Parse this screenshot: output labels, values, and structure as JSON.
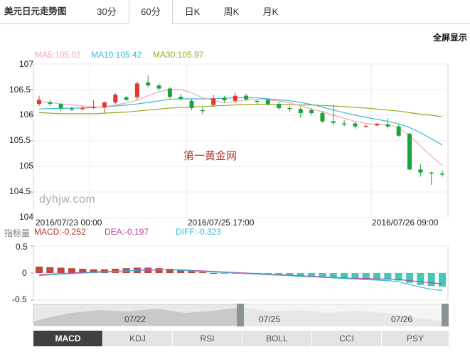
{
  "tabs": {
    "title": "美元日元走势图",
    "items": [
      "30分",
      "60分",
      "日K",
      "周K",
      "月K"
    ],
    "active": "60分"
  },
  "fullscreen_label": "全屏显示",
  "ma_legend": {
    "ma5": {
      "text": "MA5:105.02",
      "color": "#f2a5b5"
    },
    "ma10": {
      "text": "MA10:105.42",
      "color": "#3ab7d6"
    },
    "ma30": {
      "text": "MA30:105.97",
      "color": "#9aa61f"
    }
  },
  "watermark": {
    "cn": "第一黄金网",
    "url": "dyhjw.com"
  },
  "indicator_legend": {
    "label": "指标量",
    "macd": {
      "text": "MACD:-0.252",
      "color": "#b3352c"
    },
    "dea": {
      "text": "DEA:-0.197",
      "color": "#c23fa6"
    },
    "diff": {
      "text": "DIFF:-0.323",
      "color": "#3ab7d6"
    }
  },
  "navigator_labels": [
    "07/22",
    "07/25",
    "07/26"
  ],
  "indicator_tabs": [
    "MACD",
    "KDJ",
    "RSI",
    "BOLL",
    "CCI",
    "PSY"
  ],
  "indicator_active": "MACD",
  "chart_data": {
    "type": "candlestick",
    "price_axis": {
      "ticks": [
        "107",
        "106.5",
        "106",
        "105.5",
        "105",
        "104.5",
        "104"
      ],
      "ylim": [
        104,
        107
      ]
    },
    "time_axis": {
      "ticks": [
        "2016/07/23 00:00",
        "2016/07/25 17:00",
        "2016/07/26 09:00"
      ]
    },
    "candles": [
      {
        "o": 106.22,
        "c": 106.3,
        "h": 106.38,
        "l": 106.18
      },
      {
        "o": 106.25,
        "c": 106.22,
        "h": 106.3,
        "l": 106.18
      },
      {
        "o": 106.22,
        "c": 106.14,
        "h": 106.24,
        "l": 106.08
      },
      {
        "o": 106.13,
        "c": 106.11,
        "h": 106.16,
        "l": 106.08
      },
      {
        "o": 106.12,
        "c": 106.14,
        "h": 106.18,
        "l": 106.09
      },
      {
        "o": 106.14,
        "c": 106.16,
        "h": 106.3,
        "l": 106.12
      },
      {
        "o": 106.15,
        "c": 106.25,
        "h": 106.27,
        "l": 106.05
      },
      {
        "o": 106.25,
        "c": 106.4,
        "h": 106.44,
        "l": 106.22
      },
      {
        "o": 106.35,
        "c": 106.3,
        "h": 106.38,
        "l": 106.28
      },
      {
        "o": 106.35,
        "c": 106.62,
        "h": 106.66,
        "l": 106.3
      },
      {
        "o": 106.64,
        "c": 106.58,
        "h": 106.78,
        "l": 106.55
      },
      {
        "o": 106.58,
        "c": 106.52,
        "h": 106.62,
        "l": 106.48
      },
      {
        "o": 106.52,
        "c": 106.36,
        "h": 106.55,
        "l": 106.32
      },
      {
        "o": 106.36,
        "c": 106.32,
        "h": 106.42,
        "l": 106.28
      },
      {
        "o": 106.28,
        "c": 106.14,
        "h": 106.32,
        "l": 106.1
      },
      {
        "o": 106.1,
        "c": 106.08,
        "h": 106.16,
        "l": 106.02
      },
      {
        "o": 106.2,
        "c": 106.33,
        "h": 106.4,
        "l": 106.16
      },
      {
        "o": 106.34,
        "c": 106.29,
        "h": 106.38,
        "l": 106.25
      },
      {
        "o": 106.28,
        "c": 106.38,
        "h": 106.44,
        "l": 106.24
      },
      {
        "o": 106.38,
        "c": 106.31,
        "h": 106.42,
        "l": 106.28
      },
      {
        "o": 106.28,
        "c": 106.27,
        "h": 106.3,
        "l": 106.2
      },
      {
        "o": 106.3,
        "c": 106.22,
        "h": 106.32,
        "l": 106.19
      },
      {
        "o": 106.22,
        "c": 106.14,
        "h": 106.26,
        "l": 106.1
      },
      {
        "o": 106.14,
        "c": 106.12,
        "h": 106.18,
        "l": 106.06
      },
      {
        "o": 106.12,
        "c": 106.04,
        "h": 106.16,
        "l": 105.95
      },
      {
        "o": 106.1,
        "c": 106.04,
        "h": 106.14,
        "l": 106.0
      },
      {
        "o": 106.04,
        "c": 105.88,
        "h": 106.08,
        "l": 105.85
      },
      {
        "o": 105.88,
        "c": 105.85,
        "h": 106.2,
        "l": 105.8
      },
      {
        "o": 105.84,
        "c": 105.82,
        "h": 105.9,
        "l": 105.78
      },
      {
        "o": 105.84,
        "c": 105.78,
        "h": 105.88,
        "l": 105.74
      },
      {
        "o": 105.78,
        "c": 105.79,
        "h": 105.82,
        "l": 105.76
      },
      {
        "o": 105.8,
        "c": 105.83,
        "h": 105.85,
        "l": 105.79
      },
      {
        "o": 105.82,
        "c": 105.78,
        "h": 105.94,
        "l": 105.74
      },
      {
        "o": 105.78,
        "c": 105.6,
        "h": 105.82,
        "l": 105.58
      },
      {
        "o": 105.64,
        "c": 104.94,
        "h": 105.66,
        "l": 104.92
      },
      {
        "o": 104.94,
        "c": 104.88,
        "h": 105.05,
        "l": 104.8
      },
      {
        "o": 104.88,
        "c": 104.86,
        "h": 104.9,
        "l": 104.64
      },
      {
        "o": 104.86,
        "c": 104.84,
        "h": 104.92,
        "l": 104.8
      }
    ],
    "ma5": [
      106.26,
      106.25,
      106.22,
      106.2,
      106.18,
      106.16,
      106.16,
      106.2,
      106.24,
      106.29,
      106.38,
      106.46,
      106.5,
      106.5,
      106.44,
      106.34,
      106.29,
      106.24,
      106.26,
      106.3,
      106.31,
      106.3,
      106.28,
      106.24,
      106.18,
      106.12,
      106.07,
      106.0,
      105.94,
      105.88,
      105.84,
      105.82,
      105.81,
      105.76,
      105.6,
      105.4,
      105.2,
      105.02
    ],
    "ma10": [
      106.12,
      106.13,
      106.13,
      106.14,
      106.14,
      106.15,
      106.16,
      106.18,
      106.2,
      106.22,
      106.25,
      106.28,
      106.31,
      106.32,
      106.32,
      106.32,
      106.32,
      106.33,
      106.34,
      106.34,
      106.34,
      106.32,
      106.3,
      106.28,
      106.25,
      106.21,
      106.16,
      106.1,
      106.05,
      106.0,
      105.96,
      105.92,
      105.88,
      105.83,
      105.76,
      105.66,
      105.54,
      105.42
    ],
    "ma30": [
      106.05,
      106.04,
      106.03,
      106.03,
      106.03,
      106.03,
      106.04,
      106.05,
      106.06,
      106.08,
      106.1,
      106.12,
      106.14,
      106.15,
      106.16,
      106.17,
      106.18,
      106.19,
      106.2,
      106.21,
      106.21,
      106.21,
      106.21,
      106.21,
      106.2,
      106.2,
      106.19,
      106.18,
      106.17,
      106.15,
      106.14,
      106.12,
      106.1,
      106.08,
      106.05,
      106.02,
      106.0,
      105.97
    ],
    "macd_axis": {
      "ticks": [
        "0.5",
        "0",
        "-0.5"
      ],
      "ylim": [
        -0.5,
        0.5
      ]
    },
    "macd_bars": [
      0.12,
      0.11,
      0.1,
      0.09,
      0.08,
      0.07,
      0.07,
      0.08,
      0.09,
      0.1,
      0.1,
      0.09,
      0.08,
      0.06,
      0.04,
      0.02,
      0.0,
      -0.01,
      -0.01,
      -0.02,
      -0.02,
      -0.03,
      -0.04,
      -0.05,
      -0.06,
      -0.07,
      -0.08,
      -0.09,
      -0.1,
      -0.1,
      -0.11,
      -0.11,
      -0.12,
      -0.14,
      -0.18,
      -0.22,
      -0.24,
      -0.252
    ],
    "dea": [
      -0.03,
      -0.02,
      -0.01,
      0.0,
      0.01,
      0.02,
      0.03,
      0.03,
      0.04,
      0.05,
      0.05,
      0.06,
      0.06,
      0.06,
      0.05,
      0.04,
      0.03,
      0.02,
      0.01,
      0.0,
      -0.01,
      -0.02,
      -0.03,
      -0.04,
      -0.05,
      -0.06,
      -0.07,
      -0.08,
      -0.09,
      -0.1,
      -0.1,
      -0.11,
      -0.11,
      -0.12,
      -0.14,
      -0.16,
      -0.18,
      -0.197
    ],
    "diff": [
      -0.05,
      -0.03,
      -0.02,
      -0.01,
      0.0,
      0.01,
      0.02,
      0.03,
      0.04,
      0.05,
      0.06,
      0.06,
      0.06,
      0.05,
      0.04,
      0.03,
      0.02,
      0.01,
      0.0,
      -0.01,
      -0.02,
      -0.03,
      -0.04,
      -0.05,
      -0.06,
      -0.07,
      -0.08,
      -0.09,
      -0.1,
      -0.11,
      -0.12,
      -0.13,
      -0.14,
      -0.16,
      -0.21,
      -0.26,
      -0.3,
      -0.323
    ]
  }
}
